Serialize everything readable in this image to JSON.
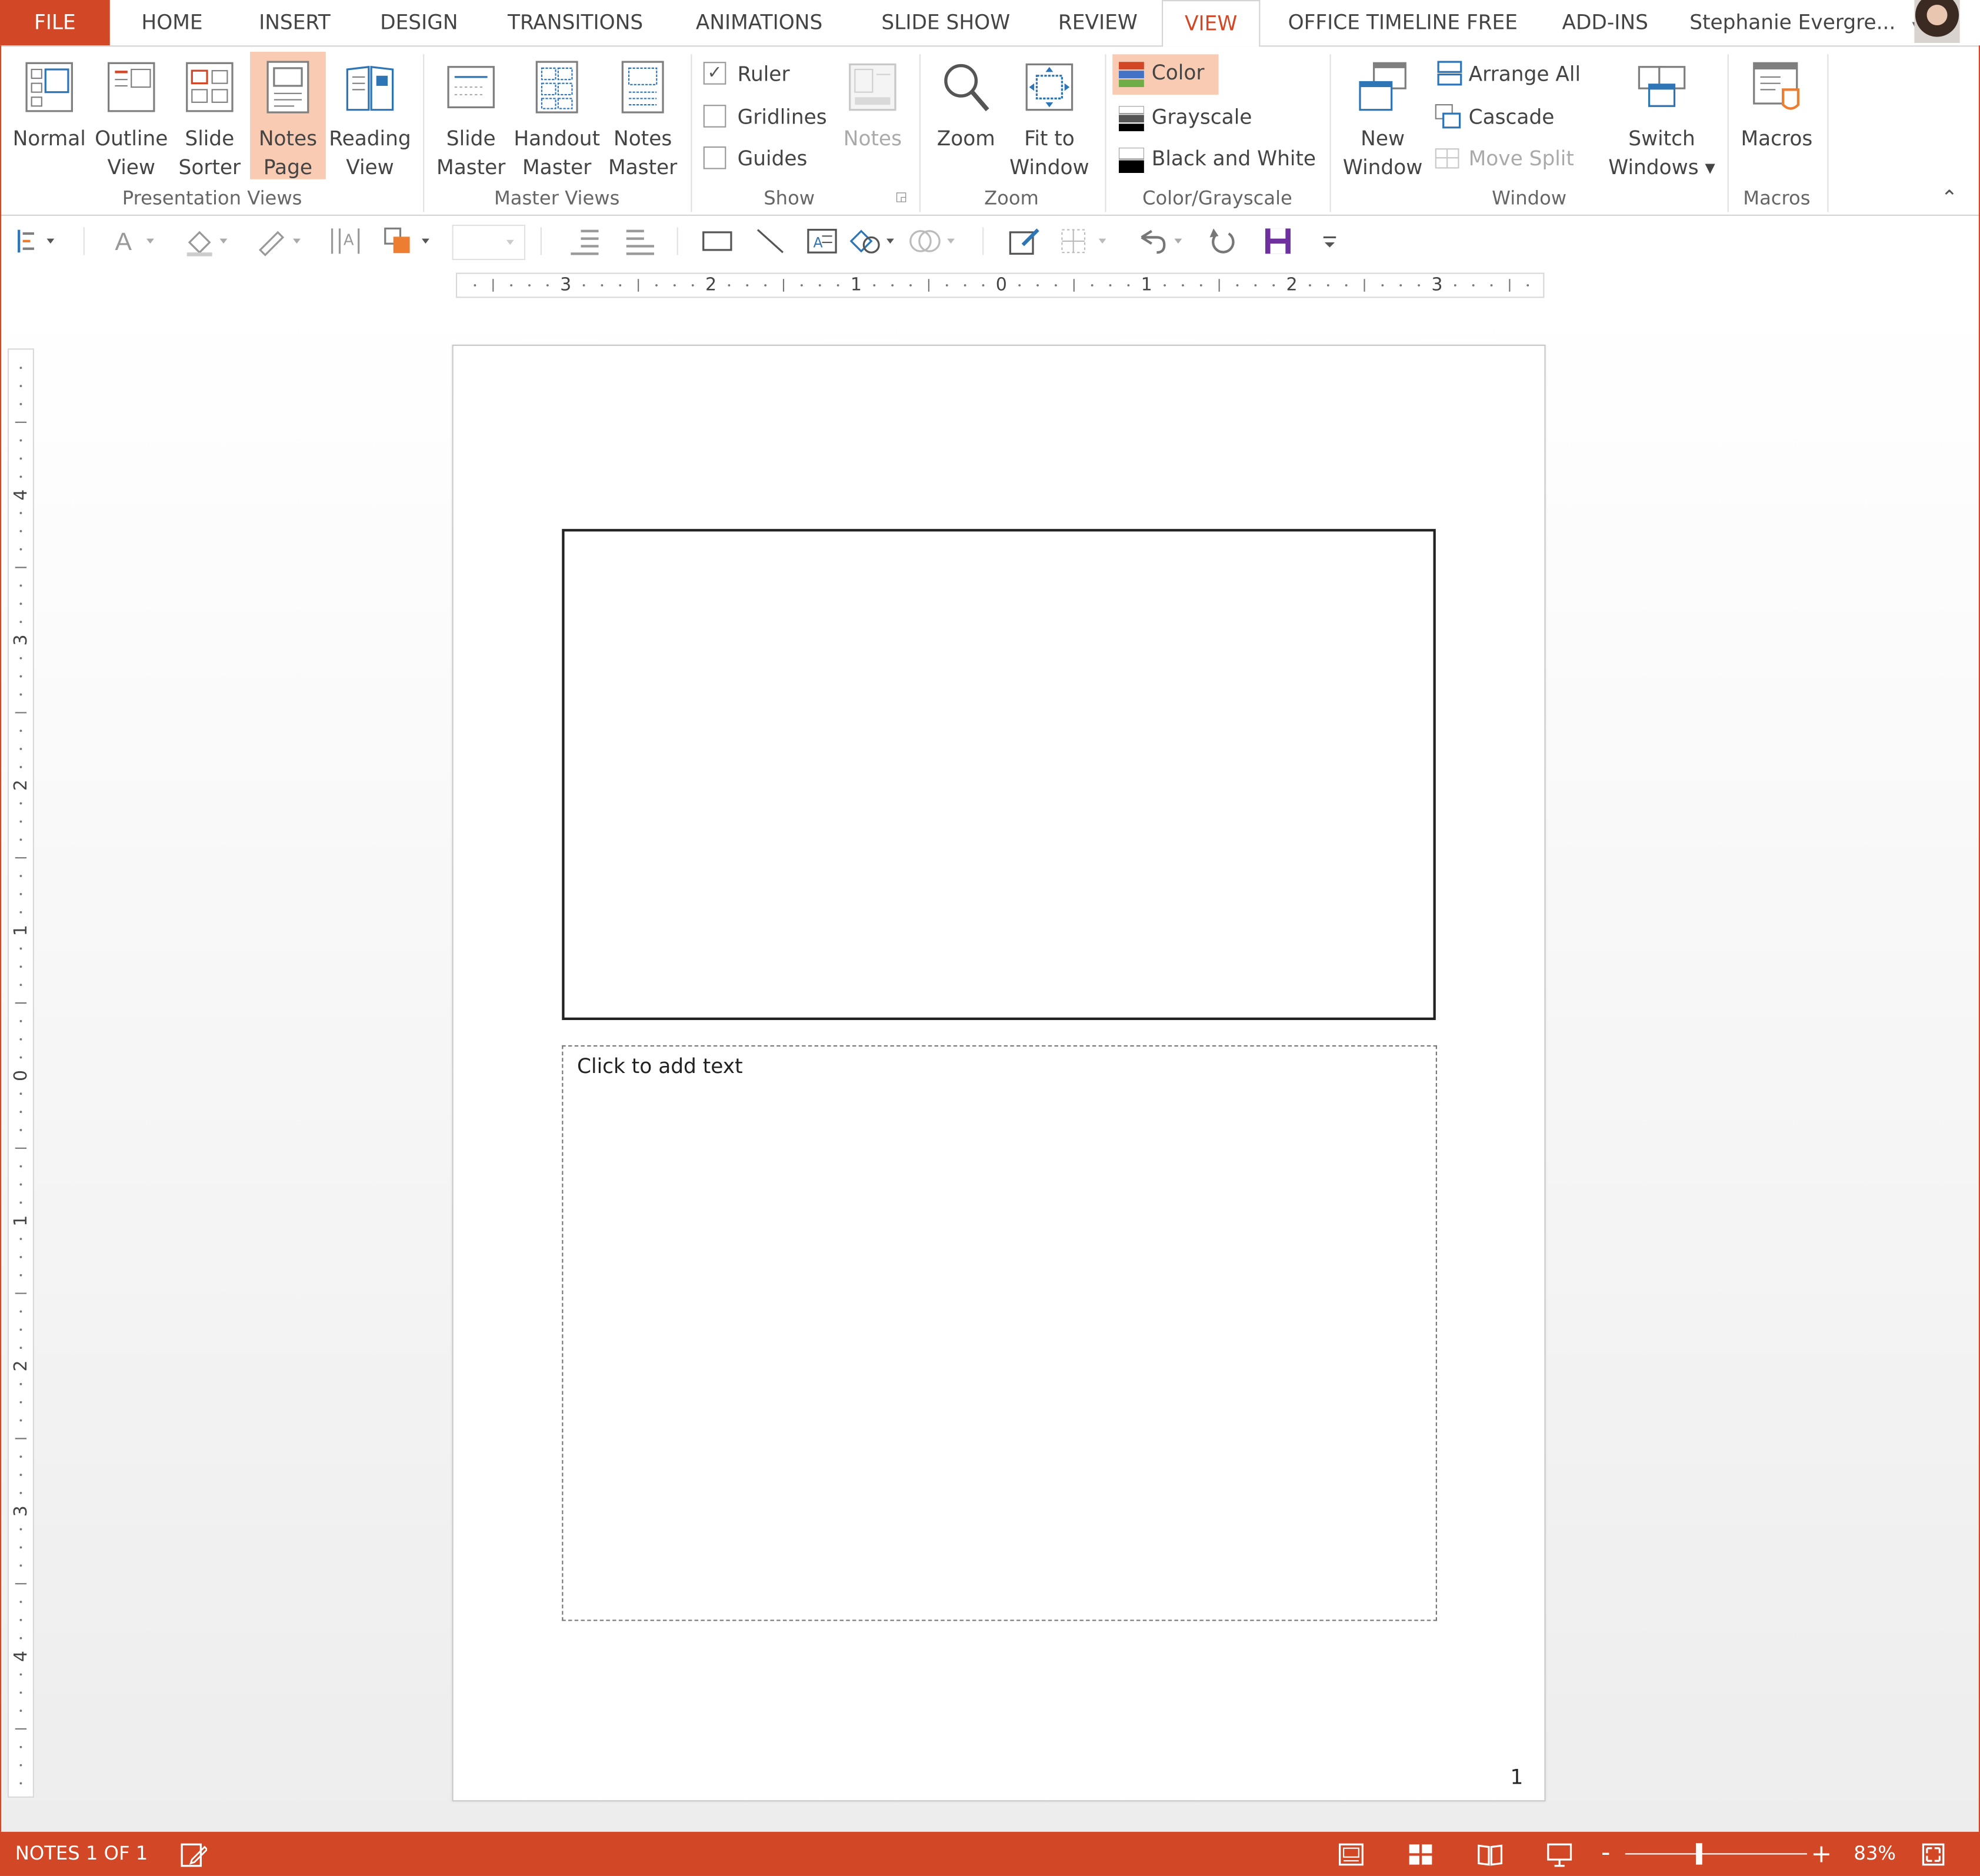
{
  "tabs": {
    "file": "FILE",
    "home": "HOME",
    "insert": "INSERT",
    "design": "DESIGN",
    "transitions": "TRANSITIONS",
    "animations": "ANIMATIONS",
    "slide_show": "SLIDE SHOW",
    "review": "REVIEW",
    "view": "VIEW",
    "office_timeline": "OFFICE TIMELINE FREE",
    "add_ins": "ADD-INS",
    "active": "VIEW"
  },
  "user": {
    "name": "Stephanie Evergre...",
    "dropdown_glyph": "▾"
  },
  "ribbon": {
    "presentation_views": {
      "group_label": "Presentation Views",
      "normal": [
        "Normal",
        ""
      ],
      "outline": [
        "Outline",
        "View"
      ],
      "slide_sorter": [
        "Slide",
        "Sorter"
      ],
      "notes_page": [
        "Notes",
        "Page"
      ],
      "reading_view": [
        "Reading",
        "View"
      ],
      "selected": "Notes Page"
    },
    "master_views": {
      "group_label": "Master Views",
      "slide_master": [
        "Slide",
        "Master"
      ],
      "handout_master": [
        "Handout",
        "Master"
      ],
      "notes_master": [
        "Notes",
        "Master"
      ]
    },
    "show": {
      "group_label": "Show",
      "ruler": "Ruler",
      "ruler_checked": true,
      "gridlines": "Gridlines",
      "gridlines_checked": false,
      "guides": "Guides",
      "guides_checked": false,
      "notes": "Notes",
      "check_glyph": "✓"
    },
    "zoom": {
      "group_label": "Zoom",
      "zoom": "Zoom",
      "fit_to_window": [
        "Fit to",
        "Window"
      ]
    },
    "color_grayscale": {
      "group_label": "Color/Grayscale",
      "color": "Color",
      "grayscale": "Grayscale",
      "black_and_white": "Black and White",
      "selected": "Color"
    },
    "window": {
      "group_label": "Window",
      "new_window": [
        "New",
        "Window"
      ],
      "arrange_all": "Arrange All",
      "cascade": "Cascade",
      "move_split": "Move Split",
      "switch_windows": [
        "Switch",
        "Windows ▾"
      ]
    },
    "macros": {
      "group_label": "Macros",
      "macros": "Macros"
    },
    "collapse_glyph": "⌃"
  },
  "ruler": {
    "horizontal": [
      "3",
      "2",
      "1",
      "0",
      "1",
      "2",
      "3"
    ],
    "vertical": [
      "4",
      "3",
      "2",
      "1",
      "0",
      "1",
      "2",
      "3",
      "4"
    ]
  },
  "notes_page": {
    "placeholder": "Click to add text",
    "page_number": "1"
  },
  "status_bar": {
    "slide_info": "NOTES 1 OF 1",
    "zoom_minus": "-",
    "zoom_plus": "+",
    "zoom_level": "83%",
    "zoom_fraction": 0.4
  },
  "colors": {
    "accent": "#d24726",
    "selected_fill": "#f9cbb3",
    "ribbon_text": "#444444"
  }
}
